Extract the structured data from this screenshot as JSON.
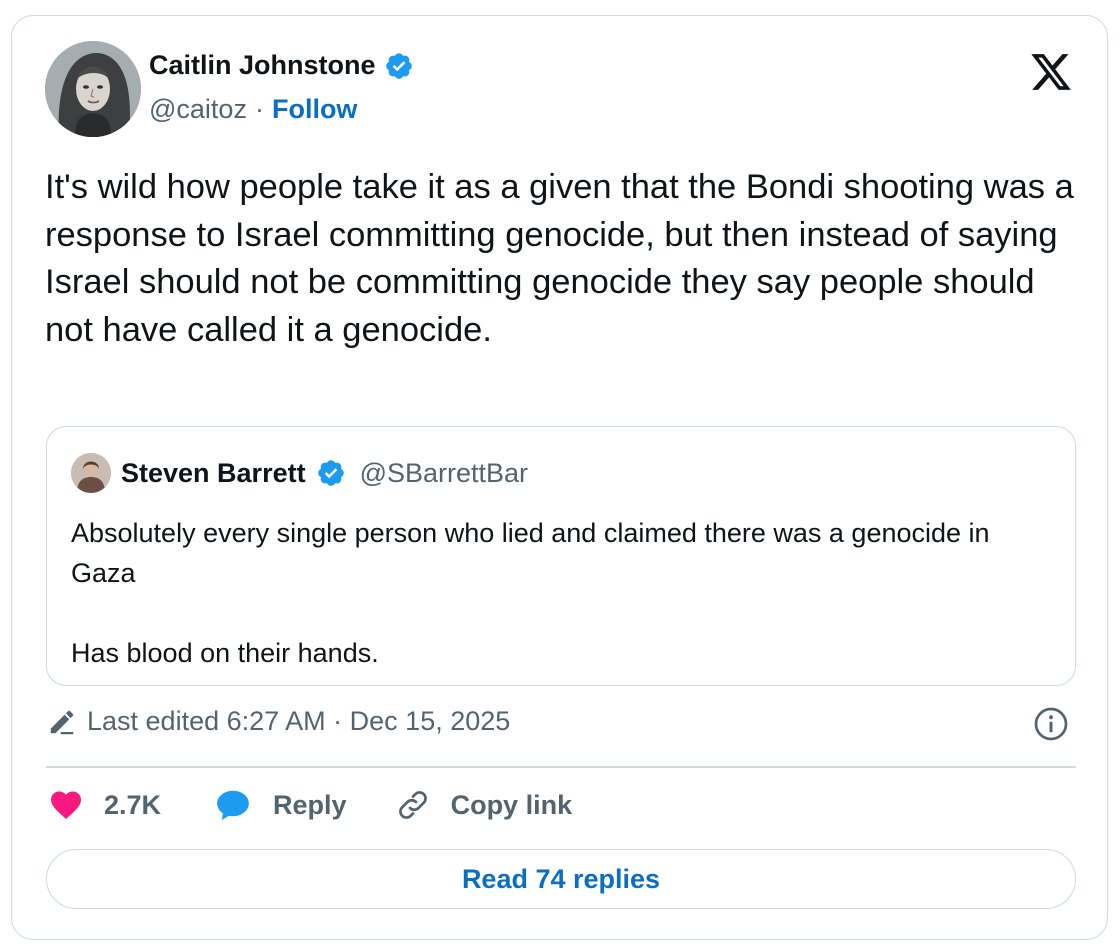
{
  "author": {
    "name": "Caitlin Johnstone",
    "handle": "@caitoz",
    "separator": "·",
    "follow_label": "Follow",
    "verified": true,
    "avatar_icon": "author-avatar"
  },
  "platform_logo": "x-logo-icon",
  "tweet_text": "It's wild how people take it as a given that the Bondi shooting was a response to Israel committing genocide, but then instead of saying Israel should not be committing genocide they say people should not have called it a genocide.",
  "quoted_tweet": {
    "name": "Steven Barrett",
    "handle": "@SBarrettBar",
    "verified": true,
    "paragraphs": [
      "Absolutely every single person who lied and claimed there was a genocide in Gaza",
      "Has blood on their hands."
    ]
  },
  "meta": {
    "edited_text": "Last edited 6:27 AM · Dec 15, 2025",
    "edit_icon": "pencil-icon",
    "info_icon": "info-icon"
  },
  "actions": {
    "like_count": "2.7K",
    "reply_label": "Reply",
    "copy_link_label": "Copy link"
  },
  "read_replies_label": "Read 74 replies",
  "colors": {
    "accent_blue": "#0b6ec5",
    "verified_blue": "#1d9bf0",
    "like_pink": "#f91880",
    "muted_text": "#536471",
    "border": "#cfd9de"
  }
}
